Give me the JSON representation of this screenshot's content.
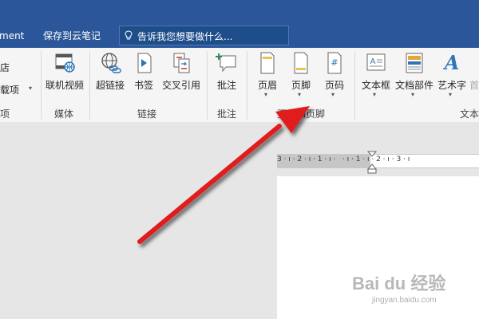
{
  "titlebar": {
    "menu_fragment": "ment",
    "save_to_cloud": "保存到云笔记",
    "search_placeholder": "告诉我您想要做什么..."
  },
  "left_group": {
    "frag1": "店",
    "frag2": "载项",
    "frag3": "项"
  },
  "ribbon": {
    "media": {
      "online_video": "联机视频",
      "group": "媒体"
    },
    "links": {
      "hyperlink": "超链接",
      "bookmark": "书签",
      "cross_ref": "交叉引用",
      "group": "链接"
    },
    "comments": {
      "comment": "批注",
      "group": "批注"
    },
    "header_footer": {
      "header": "页眉",
      "footer": "页脚",
      "page_number": "页码",
      "group": "页眉和页脚"
    },
    "text": {
      "textbox": "文本框",
      "doc_parts": "文档部件",
      "wordart": "艺术字",
      "first_char": "首",
      "group": "文本"
    }
  },
  "ruler": {
    "marks": "3 · ı · 2 · ı · 1 · ı ·   · ı · 1 · ı · 2 · ı · 3 · ı"
  },
  "watermark": {
    "brand": "Bai du 经验",
    "url": "jingyan.baidu.com"
  },
  "colors": {
    "titlebar": "#2b579a",
    "ribbon": "#f5f5f5",
    "arrow": "#e11b1b"
  }
}
